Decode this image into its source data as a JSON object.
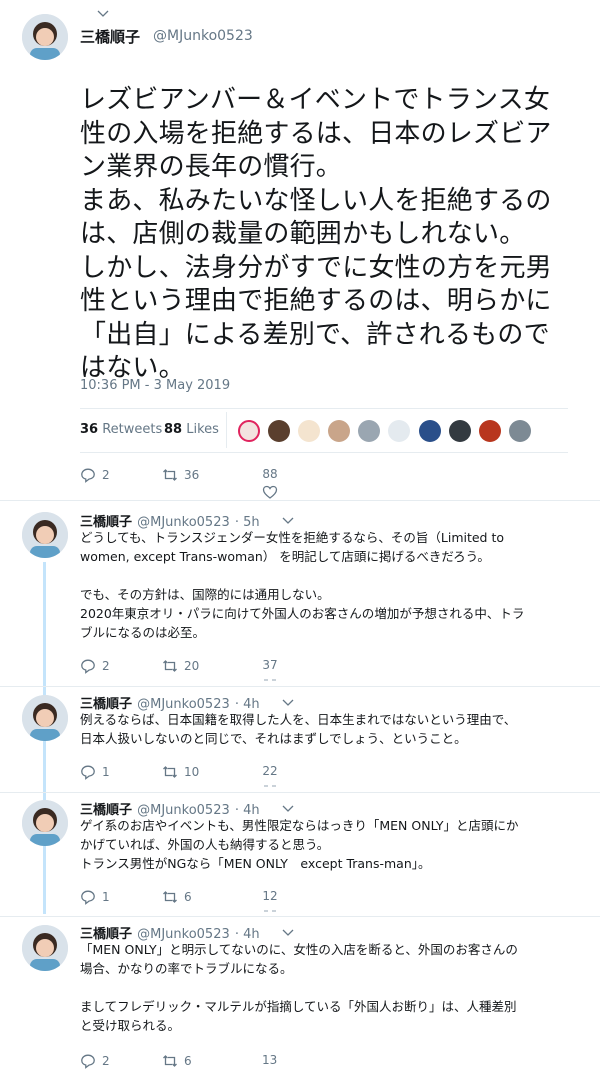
{
  "main_tweet": {
    "author_name": "三橋順子",
    "author_handle": "@MJunko0523",
    "text_lines": [
      "レズビアンバー＆イベントでトランス女",
      "性の入場を拒絶するは、日本のレズビア",
      "ン業界の長年の慣行。",
      "まあ、私みたいな怪しい人を拒絶するの",
      "は、店側の裁量の範囲かもしれない。",
      "しかし、法身分がすでに女性の方を元男",
      "性という理由で拒絶するのは、明らかに",
      "「出自」による差別で、許されるもので",
      "はない。"
    ],
    "timestamp": "10:36 PM - 3 May 2019",
    "retweets_count": "36",
    "retweets_label": "Retweets",
    "likes_count": "88",
    "likes_label": "Likes",
    "actions": {
      "replies": "2",
      "retweets": "36",
      "likes": "88"
    }
  },
  "replies": [
    {
      "author_name": "三橋順子",
      "author_handle": "@MJunko0523",
      "time": "· 5h",
      "text": "どうしても、トランスジェンダー女性を拒絶するなら、その旨（Limited to\nwomen, except Trans-woman） を明記して店頭に掲げるべきだろう。\n\nでも、その方針は、国際的には通用しない。\n2020年東京オリ・パラに向けて外国人のお客さんの増加が予想される中、トラ\nブルになるのは必至。",
      "replies": "2",
      "retweets": "20",
      "likes": "37"
    },
    {
      "author_name": "三橋順子",
      "author_handle": "@MJunko0523",
      "time": "· 4h",
      "text": "例えるならば、日本国籍を取得した人を、日本生まれではないという理由で、\n日本人扱いしないのと同じで、それはまずしでしょう、ということ。",
      "replies": "1",
      "retweets": "10",
      "likes": "22"
    },
    {
      "author_name": "三橋順子",
      "author_handle": "@MJunko0523",
      "time": "· 4h",
      "text": "ゲイ系のお店やイベントも、男性限定ならはっきり「MEN ONLY」と店頭にか\nかげていれば、外国の人も納得すると思う。\nトランス男性がNGなら「MEN ONLY　except Trans-man」。",
      "replies": "1",
      "retweets": "6",
      "likes": "12"
    },
    {
      "author_name": "三橋順子",
      "author_handle": "@MJunko0523",
      "time": "· 4h",
      "text": "「MEN ONLY」と明示してないのに、女性の入店を断ると、外国のお客さんの\n場合、かなりの率でトラブルになる。\n\nましてフレデリック・マルテルが指摘している「外国人お断り」は、人種差別\nと受け取られる。",
      "replies": "2",
      "retweets": "6",
      "likes": "13"
    }
  ],
  "icons": {
    "reply": "reply-icon",
    "retweet": "retweet-icon",
    "like": "heart-icon",
    "more": "chevron-down-icon"
  },
  "colors": {
    "text": "#14171a",
    "secondary": "#657786",
    "thread_line": "#c4e4fb",
    "divider": "#e6ecf0"
  }
}
